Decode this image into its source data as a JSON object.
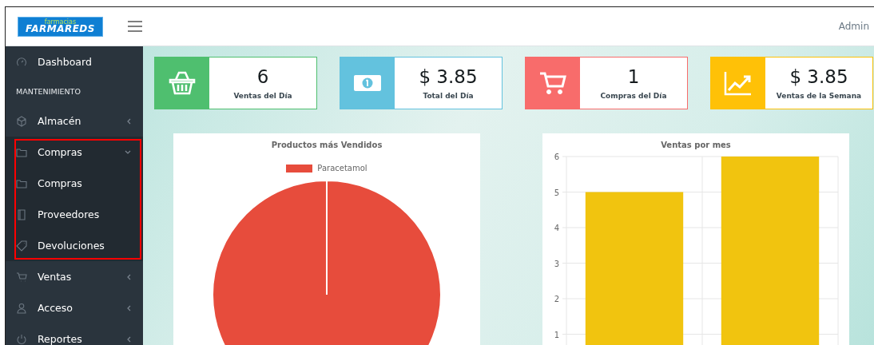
{
  "topbar": {
    "logo_small": "farmacias",
    "logo_main": "FARMAREDS",
    "user": "Admin"
  },
  "sidebar": {
    "items": [
      {
        "kind": "link",
        "label": "Dashboard"
      },
      {
        "kind": "header",
        "label": "MANTENIMIENTO"
      },
      {
        "kind": "menu",
        "label": "Almacén",
        "expanded": false,
        "highlighted": false
      },
      {
        "kind": "menu",
        "label": "Compras",
        "expanded": true,
        "highlighted": true,
        "children": [
          {
            "label": "Compras"
          },
          {
            "label": "Proveedores"
          },
          {
            "label": "Devoluciones"
          }
        ]
      },
      {
        "kind": "menu",
        "label": "Ventas",
        "expanded": false,
        "highlighted": false
      },
      {
        "kind": "menu",
        "label": "Acceso",
        "expanded": false,
        "highlighted": false
      },
      {
        "kind": "menu",
        "label": "Reportes",
        "expanded": false,
        "highlighted": false
      }
    ]
  },
  "stats": [
    {
      "value": "6",
      "label": "Ventas del Día",
      "color": "#4fbf6f"
    },
    {
      "value": "$ 3.85",
      "label": "Total del Día",
      "color": "#63c2de"
    },
    {
      "value": "1",
      "label": "Compras del Día",
      "color": "#f86c6b"
    },
    {
      "value": "$ 3.85",
      "label": "Ventas de la Semana",
      "color": "#ffc107"
    }
  ],
  "charts": [
    {
      "chart_data": {
        "type": "pie",
        "title": "Productos más Vendidos",
        "categories": [
          "Paracetamol"
        ],
        "series": [
          {
            "color": "#e74c3c",
            "values": [
              1
            ]
          }
        ]
      }
    },
    {
      "chart_data": {
        "type": "bar",
        "title": "Ventas por mes",
        "series": [
          {
            "color": "#f1c40f",
            "values": [
              5,
              6
            ]
          }
        ],
        "ylim": [
          0,
          6
        ],
        "yticks": [
          1,
          2,
          3,
          4,
          5,
          6
        ],
        "grid": true
      }
    }
  ]
}
